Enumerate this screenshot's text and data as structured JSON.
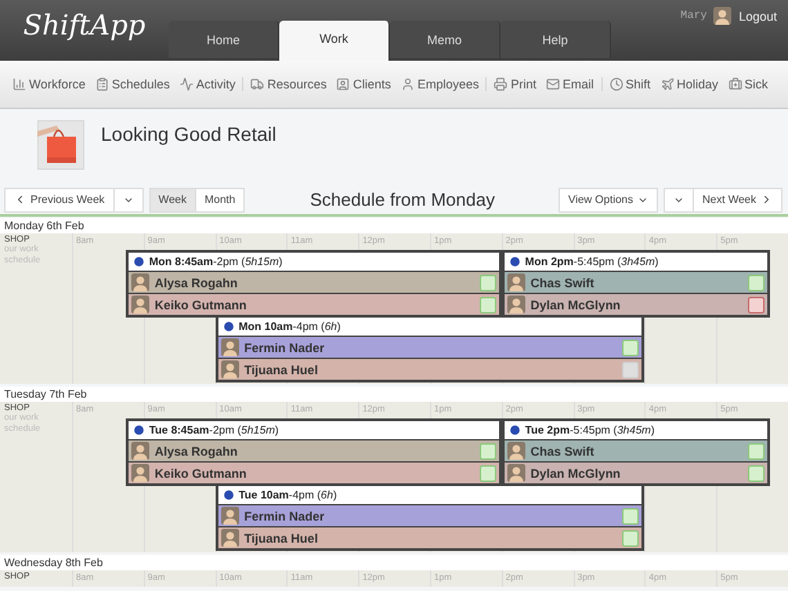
{
  "header": {
    "logo": "ShiftApp",
    "tabs": [
      {
        "label": "Home",
        "selected": false
      },
      {
        "label": "Work",
        "selected": true
      },
      {
        "label": "Memo",
        "selected": false
      },
      {
        "label": "Help",
        "selected": false
      }
    ],
    "user": "Mary",
    "logout": "Logout"
  },
  "toolbar": [
    [
      {
        "label": "Workforce"
      },
      {
        "label": "Schedules"
      },
      {
        "label": "Activity"
      }
    ],
    [
      {
        "label": "Resources"
      },
      {
        "label": "Clients"
      },
      {
        "label": "Employees"
      }
    ],
    [
      {
        "label": "Print"
      },
      {
        "label": "Email"
      }
    ],
    [
      {
        "label": "Shift"
      },
      {
        "label": "Holiday"
      },
      {
        "label": "Sick"
      }
    ]
  ],
  "company": {
    "name": "Looking Good Retail"
  },
  "controls": {
    "previous": "Previous Week",
    "views": [
      {
        "label": "Week",
        "selected": true
      },
      {
        "label": "Month",
        "selected": false
      }
    ],
    "title": "Schedule from Monday",
    "options": "View Options",
    "next": "Next Week"
  },
  "days": [
    {
      "title": "Monday 6th Feb",
      "location": "SHOP",
      "subtitle": "our work schedule",
      "hours": [
        "8am",
        "9am",
        "10am",
        "11am",
        "12pm",
        "1pm",
        "2pm",
        "3pm",
        "4pm",
        "5pm"
      ],
      "shifts": [
        {
          "label": "**Mon 8:45am**-2pm (*5h15m*)",
          "staff": [
            {
              "name": "Alysa Rogahn",
              "color": "#bfb5a6",
              "kind": "confirmed"
            },
            {
              "name": "Keiko Gutmann",
              "color": "#d4b3ae",
              "kind": "confirmed"
            }
          ]
        },
        {
          "label": "**Mon 2pm**-5:45pm (*3h45m*)",
          "staff": [
            {
              "name": "Chas Swift",
              "color": "#9fb3b0",
              "kind": "confirmed"
            },
            {
              "name": "Dylan McGlynn",
              "color": "#c9b2b0",
              "kind": "declined"
            }
          ]
        },
        {
          "label": "**Mon 10am**-4pm (*6h*)",
          "staff": [
            {
              "name": "Fermin Nader",
              "color": "#a7a1d9",
              "kind": "confirmed"
            },
            {
              "name": "Tijuana Huel",
              "color": "#d4b3aa",
              "kind": "pending"
            }
          ]
        }
      ]
    },
    {
      "title": "Tuesday 7th Feb",
      "location": "SHOP",
      "subtitle": "our work schedule",
      "hours": [
        "8am",
        "9am",
        "10am",
        "11am",
        "12pm",
        "1pm",
        "2pm",
        "3pm",
        "4pm",
        "5pm"
      ],
      "shifts": [
        {
          "label": "**Tue 8:45am**-2pm (*5h15m*)",
          "staff": [
            {
              "name": "Alysa Rogahn",
              "color": "#bfb5a6",
              "kind": "confirmed"
            },
            {
              "name": "Keiko Gutmann",
              "color": "#d4b3ae",
              "kind": "confirmed"
            }
          ]
        },
        {
          "label": "**Tue 2pm**-5:45pm (*3h45m*)",
          "staff": [
            {
              "name": "Chas Swift",
              "color": "#9fb3b0",
              "kind": "confirmed"
            },
            {
              "name": "Dylan McGlynn",
              "color": "#c9b2b0",
              "kind": "confirmed"
            }
          ]
        },
        {
          "label": "**Tue 10am**-4pm (*6h*)",
          "staff": [
            {
              "name": "Fermin Nader",
              "color": "#a7a1d9",
              "kind": "confirmed"
            },
            {
              "name": "Tijuana Huel",
              "color": "#d4b3aa",
              "kind": "confirmed"
            }
          ]
        }
      ]
    },
    {
      "title": "Wednesday 8th Feb",
      "location": "SHOP",
      "hours": [
        "8am",
        "9am",
        "10am",
        "11am",
        "12pm",
        "1pm",
        "2pm",
        "3pm",
        "4pm",
        "5pm"
      ]
    }
  ]
}
